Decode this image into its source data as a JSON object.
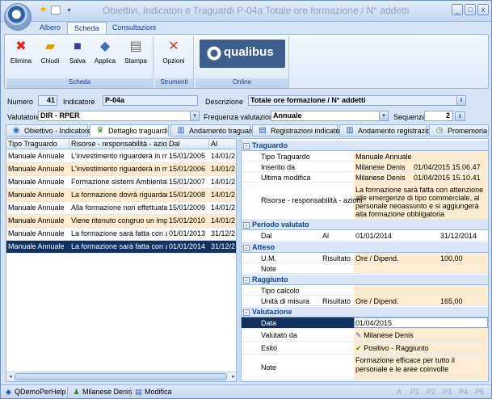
{
  "window": {
    "title": "Obiettivi, Indicatori e Traguardi P-04a Totale ore formazione / N° addetti",
    "quick_access": [
      "star-icon",
      "note-icon",
      "dropdown-icon"
    ]
  },
  "ribbon": {
    "tabs": [
      "Albero",
      "Scheda",
      "Consultazioni"
    ],
    "active_tab": "Scheda",
    "groups": [
      {
        "label": "Scheda",
        "buttons": [
          "Elimina",
          "Chiudi",
          "Salva",
          "Applica",
          "Stampa"
        ]
      },
      {
        "label": "Strumenti",
        "buttons": [
          "Opzioni"
        ]
      },
      {
        "label": "Online",
        "logo": "qualibus"
      }
    ]
  },
  "form": {
    "numero_label": "Numero",
    "numero_value": "41",
    "indicatore_label": "Indicatore",
    "indicatore_value": "P-04a",
    "descrizione_label": "Descrizione",
    "descrizione_value": "Totale ore formazione / N° addetti",
    "valutatore_label": "Valutatore",
    "valutatore_value": "DIR - RPER",
    "frequenza_label": "Frequenza valutazione",
    "frequenza_value": "Annuale",
    "sequenza_label": "Sequenza",
    "sequenza_value": "2"
  },
  "page_tabs": [
    {
      "label": "Obiettivo - Indicatore",
      "icon": "target-icon"
    },
    {
      "label": "Dettaglio traguardi",
      "icon": "trophy-icon"
    },
    {
      "label": "Andamento traguardi",
      "icon": "chart-icon"
    },
    {
      "label": "Registrazioni indicatore",
      "icon": "list-icon"
    },
    {
      "label": "Andamento registrazioni",
      "icon": "chart-icon"
    },
    {
      "label": "Promemoria",
      "icon": "clock-icon"
    }
  ],
  "grid": {
    "headers": [
      "Tipo Traguardo",
      "Risorse - responsabilità - azioni",
      "Dal",
      "Al"
    ],
    "rows": [
      [
        "Manuale Annuale",
        "L'investimento riguarderà in modo",
        "15/01/2005",
        "14/01/2"
      ],
      [
        "Manuale Annuale",
        "L'investimento riguarderà in modo",
        "15/01/2006",
        "14/01/2"
      ],
      [
        "Manuale Annuale",
        "Formazione sistemi Ambientale se",
        "15/01/2007",
        "14/01/2"
      ],
      [
        "Manuale Annuale",
        "La formazione dovrà riguardare t",
        "15/01/2008",
        "14/01/2"
      ],
      [
        "Manuale Annuale",
        "Alla formazione non effettuata ne",
        "15/01/2009",
        "14/01/2"
      ],
      [
        "Manuale Annuale",
        "Viene ritenuto congruo un impegr",
        "15/01/2010",
        "14/01/2"
      ],
      [
        "Manuale Annuale",
        "La formazione sarà fatta con atte",
        "01/01/2013",
        "31/12/2"
      ],
      [
        "Manuale Annuale",
        "La formazione sarà fatta con atte",
        "01/01/2014",
        "31/12/2"
      ]
    ],
    "selected_row": 7
  },
  "details": {
    "traguardo": {
      "title": "Traguardo",
      "tipo_label": "Tipo Traguardo",
      "tipo_value": "Manuale Annuale",
      "inserito_label": "Inserito da",
      "inserito_value": "Milanese Denis",
      "inserito_date": "01/04/2015 15.06.47",
      "modifica_label": "Ultima modifica",
      "modifica_value": "Milanese Denis",
      "modifica_date": "01/04/2015 15.10.41",
      "risorse_label": "Risorse - responsabilità - azioni",
      "risorse_value": "La formazione sarà fatta con attenzione alle emergenze di tipo commerciale, al personale neoassunto e si aggiungerà alla formazione obbligatoria"
    },
    "periodo": {
      "title": "Periodo valutato",
      "dal_label": "Dal",
      "al_label": "Al",
      "dal_value": "01/01/2014",
      "al_value": "31/12/2014"
    },
    "atteso": {
      "title": "Atteso",
      "um_label": "U.M.",
      "risultato_label": "Risultato",
      "um_value": "Ore / Dipend.",
      "risultato_value": "100,00",
      "note_label": "Note"
    },
    "raggiunto": {
      "title": "Raggiunto",
      "tipo_calcolo_label": "Tipo calcolo",
      "unita_label": "Unità di misura",
      "risultato_label": "Risultato",
      "unita_value": "Ore / Dipend.",
      "risultato_value": "165,00"
    },
    "valutazione": {
      "title": "Valutazione",
      "data_label": "Data",
      "data_value": "01/04/2015",
      "valutato_label": "Valutato da",
      "valutato_value": "Milanese Denis",
      "esito_label": "Esito",
      "esito_value": "Positivo - Raggiunto",
      "note_label": "Note",
      "note_value": "Formazione efficace per tutto il personale e le aree coinvolte"
    }
  },
  "statusbar": {
    "items": [
      "QDemoPerHelp",
      "Milanese Denis",
      "Modifica"
    ],
    "pages": [
      "A",
      "P1",
      "P2",
      "P3",
      "P4",
      "P5"
    ]
  }
}
